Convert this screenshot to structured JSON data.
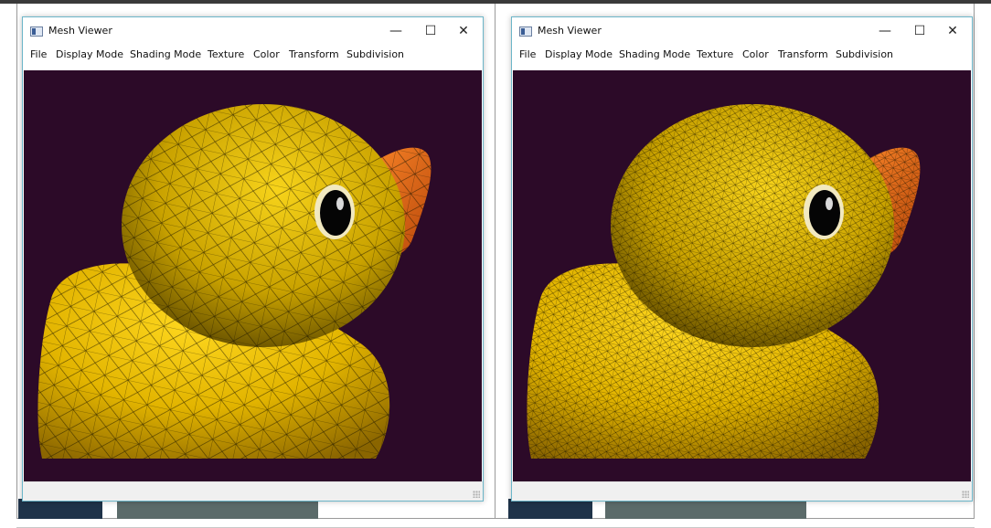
{
  "panels": [
    {
      "window_title": "Mesh Viewer",
      "menu": [
        "File",
        "Display Mode",
        "Shading Mode",
        "Texture",
        "Color",
        "Transform",
        "Subdivision"
      ],
      "controls": {
        "minimize": "—",
        "maximize": "☐",
        "close": "✕"
      },
      "mesh_density": "coarse"
    },
    {
      "window_title": "Mesh Viewer",
      "menu": [
        "File",
        "Display Mode",
        "Shading Mode",
        "Texture",
        "Color",
        "Transform",
        "Subdivision"
      ],
      "controls": {
        "minimize": "—",
        "maximize": "☐",
        "close": "✕"
      },
      "mesh_density": "fine"
    }
  ],
  "colors": {
    "viewport_background": "#2c0a28",
    "duck_yellow": "#e8c200",
    "beak_orange": "#e06a10",
    "wire": "#1a1400",
    "window_border": "#6cb6c9"
  },
  "icons": [
    "app-window-icon",
    "minimize-icon",
    "maximize-icon",
    "close-icon",
    "resize-grip-icon"
  ]
}
